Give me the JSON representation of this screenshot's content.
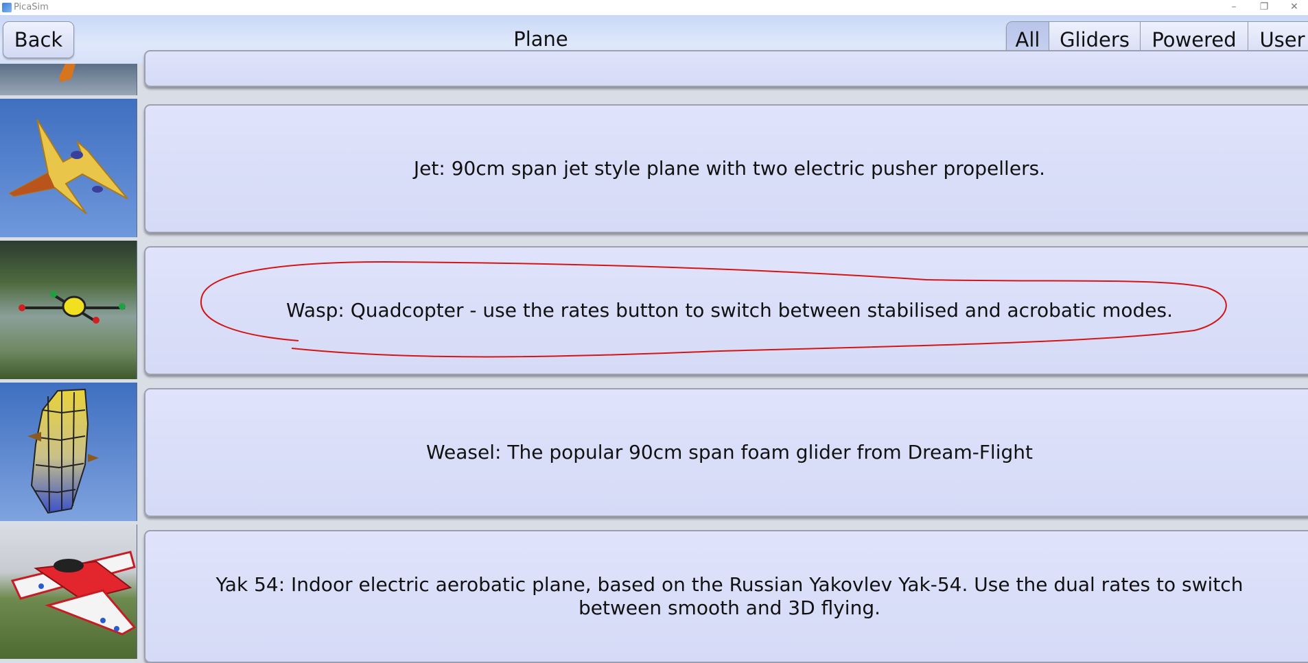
{
  "window": {
    "title": "PicaSim",
    "icon": "picasim-app-icon",
    "controls": [
      "minimize-icon",
      "restore-icon",
      "close-icon"
    ]
  },
  "header": {
    "back_label": "Back",
    "title": "Plane",
    "filters": [
      {
        "label": "All",
        "active": true
      },
      {
        "label": "Gliders",
        "active": false
      },
      {
        "label": "Powered",
        "active": false
      },
      {
        "label": "User",
        "active": false
      }
    ]
  },
  "models": [
    {
      "description": ""
    },
    {
      "description": "Jet: 90cm span jet style plane with two electric pusher propellers."
    },
    {
      "description": "Wasp: Quadcopter - use the rates button to switch between stabilised and acrobatic modes."
    },
    {
      "description": "Weasel: The popular 90cm span foam glider from Dream-Flight"
    },
    {
      "description": "Yak 54: Indoor electric aerobatic plane, based on the Russian Yakovlev Yak-54. Use the dual rates to switch between smooth and 3D flying."
    }
  ],
  "colors": {
    "annotation": "#d41515",
    "card": "#d9ddf8",
    "header": "#d4e0f8"
  }
}
